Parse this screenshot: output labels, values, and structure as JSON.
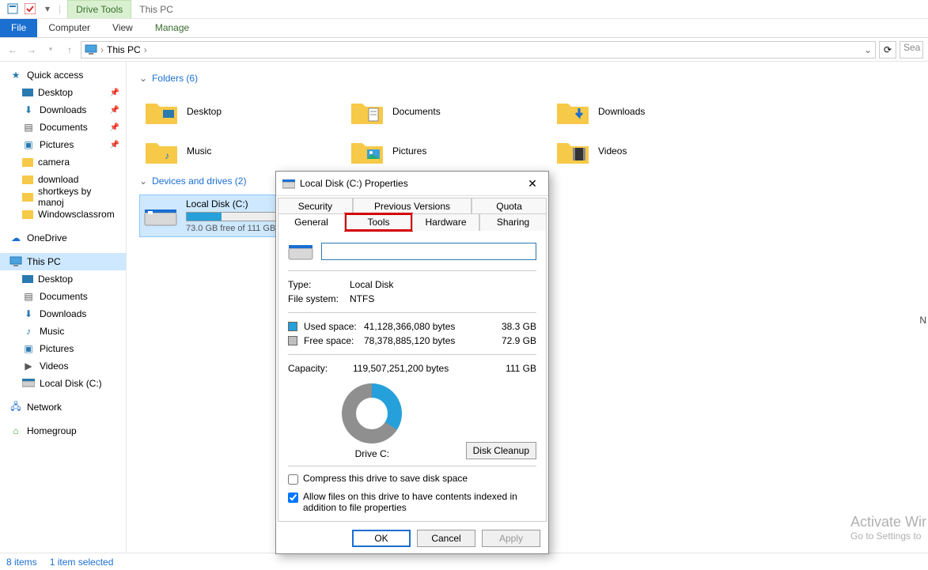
{
  "quick_access_title": "Quick access",
  "ribbon": {
    "file": "File",
    "computer": "Computer",
    "view": "View",
    "drive_tools": "Drive Tools",
    "manage": "Manage",
    "this_pc_tab": "This PC"
  },
  "address": {
    "location": "This PC",
    "dropdown": "⌄",
    "search_placeholder": "Sea"
  },
  "sidebar": {
    "quick_access": "Quick access",
    "desktop": "Desktop",
    "downloads": "Downloads",
    "documents": "Documents",
    "pictures": "Pictures",
    "camera": "camera",
    "download": "download",
    "shortkeys": "shortkeys by manoj",
    "windowsclassroom": "Windowsclassrom",
    "onedrive": "OneDrive",
    "thispc": "This PC",
    "thispc_desktop": "Desktop",
    "thispc_documents": "Documents",
    "thispc_downloads": "Downloads",
    "thispc_music": "Music",
    "thispc_pictures": "Pictures",
    "thispc_videos": "Videos",
    "thispc_localdisk": "Local Disk (C:)",
    "network": "Network",
    "homegroup": "Homegroup"
  },
  "groups": {
    "folders_header": "Folders (6)",
    "folders": [
      {
        "label": "Desktop"
      },
      {
        "label": "Documents"
      },
      {
        "label": "Downloads"
      },
      {
        "label": "Music"
      },
      {
        "label": "Pictures"
      },
      {
        "label": "Videos"
      }
    ],
    "devices_header": "Devices and drives (2)",
    "drive": {
      "name": "Local Disk (C:)",
      "free_text": "73.0 GB free of 111 GB",
      "fill_pct": 34
    }
  },
  "dialog": {
    "title": "Local Disk (C:) Properties",
    "tabs": {
      "security": "Security",
      "previous": "Previous Versions",
      "quota": "Quota",
      "general": "General",
      "tools": "Tools",
      "hardware": "Hardware",
      "sharing": "Sharing"
    },
    "label_value": "",
    "type_k": "Type:",
    "type_v": "Local Disk",
    "fs_k": "File system:",
    "fs_v": "NTFS",
    "used_k": "Used space:",
    "used_bytes": "41,128,366,080 bytes",
    "used_gb": "38.3 GB",
    "free_k": "Free space:",
    "free_bytes": "78,378,885,120 bytes",
    "free_gb": "72.9 GB",
    "cap_k": "Capacity:",
    "cap_bytes": "119,507,251,200 bytes",
    "cap_gb": "111 GB",
    "drive_label": "Drive C:",
    "cleanup": "Disk Cleanup",
    "compress": "Compress this drive to save disk space",
    "index": "Allow files on this drive to have contents indexed in addition to file properties",
    "ok": "OK",
    "cancel": "Cancel",
    "apply": "Apply"
  },
  "status": {
    "items": "8 items",
    "selected": "1 item selected"
  },
  "activate": {
    "title": "Activate Wir",
    "sub": "Go to Settings to"
  },
  "right_letter": "N"
}
